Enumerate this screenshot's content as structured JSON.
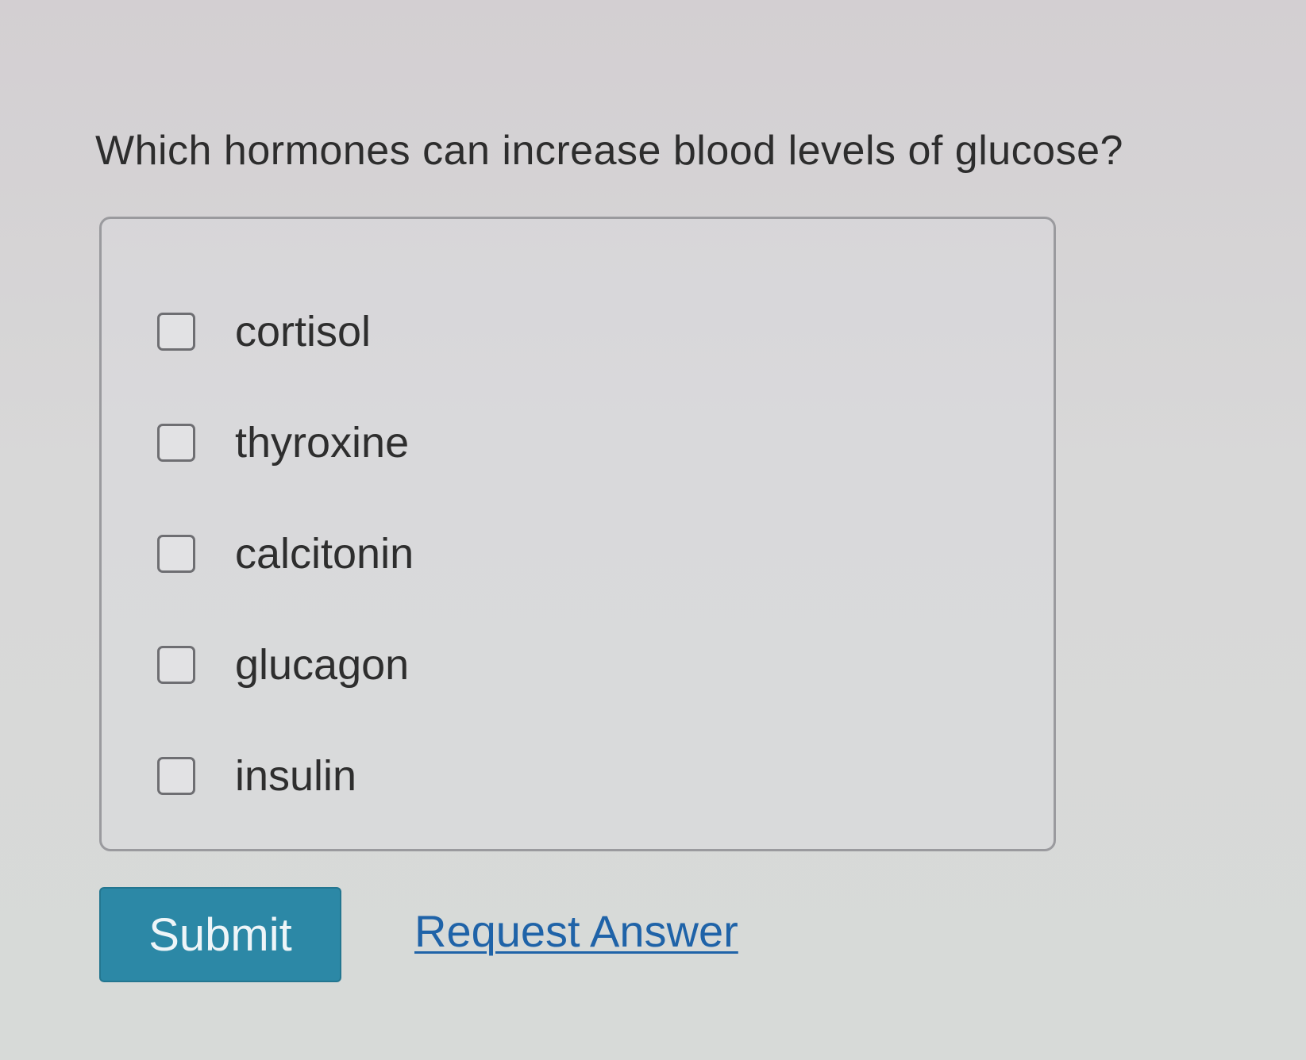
{
  "question": {
    "text": "Which hormones can increase blood levels of glucose?"
  },
  "options": [
    {
      "label": "cortisol",
      "checked": false
    },
    {
      "label": "thyroxine",
      "checked": false
    },
    {
      "label": "calcitonin",
      "checked": false
    },
    {
      "label": "glucagon",
      "checked": false
    },
    {
      "label": "insulin",
      "checked": false
    }
  ],
  "actions": {
    "submit_label": "Submit",
    "request_answer_label": "Request Answer"
  },
  "colors": {
    "submit_button": "#2c88a6",
    "link": "#1f63a8"
  }
}
